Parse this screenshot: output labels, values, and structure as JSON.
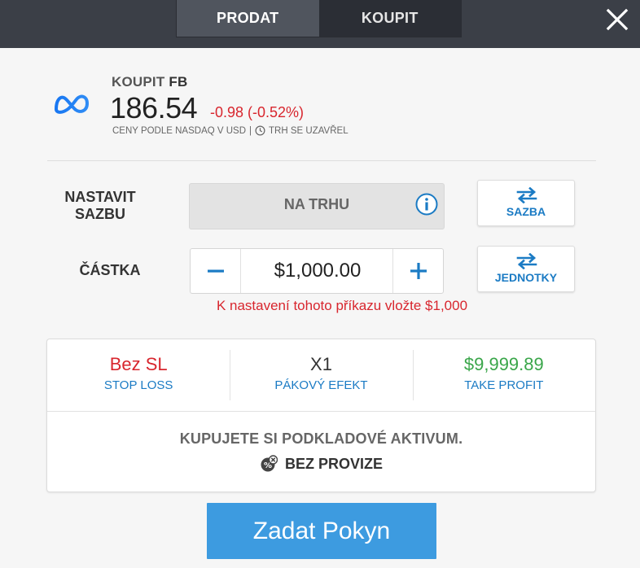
{
  "tabs": [
    {
      "label": "PRODAT"
    },
    {
      "label": "KOUPIT"
    }
  ],
  "header": {
    "action": "KOUPIT",
    "symbol": "FB",
    "price": "186.54",
    "change": "-0.98 (-0.52%)",
    "prices_note": "CENY PODLE NASDAQ V USD",
    "separator": "|",
    "market_status": "TRH SE UZAVŘEL"
  },
  "rate": {
    "label": "NASTAVIT SAZBU",
    "value": "NA TRHU",
    "side_button": "SAZBA"
  },
  "amount": {
    "label": "ČÁSTKA",
    "value": "$1,000.00",
    "side_button": "JEDNOTKY",
    "warning": "K nastavení tohoto příkazu vložte $1,000"
  },
  "stats": [
    {
      "value": "Bez SL",
      "label": "STOP LOSS",
      "color": "#d8262e"
    },
    {
      "value": "X1",
      "label": "PÁKOVÝ EFEKT",
      "color": "#333333"
    },
    {
      "value": "$9,999.89",
      "label": "TAKE PROFIT",
      "color": "#3aa64a"
    }
  ],
  "note": "KUPUJETE SI PODKLADOVÉ AKTIVUM.",
  "fee": "BEZ PROVIZE",
  "submit": "Zadat Pokyn",
  "colors": {
    "accent": "#3d9be0",
    "link": "#1b7bc4",
    "negative": "#d8262e",
    "positive": "#3aa64a"
  },
  "icons": {
    "logo": "meta-logo-icon",
    "close": "close-icon",
    "clock": "clock-icon",
    "info": "info-icon",
    "swap": "swap-arrows-icon",
    "fee": "no-commission-icon"
  }
}
